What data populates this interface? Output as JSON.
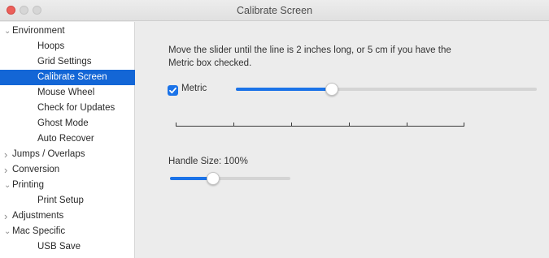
{
  "window": {
    "title": "Calibrate Screen"
  },
  "sidebar": {
    "items": [
      {
        "label": "Environment",
        "level": 0,
        "expander": "expanded",
        "selected": false
      },
      {
        "label": "Hoops",
        "level": 1,
        "selected": false
      },
      {
        "label": "Grid Settings",
        "level": 1,
        "selected": false
      },
      {
        "label": "Calibrate Screen",
        "level": 1,
        "selected": true
      },
      {
        "label": "Mouse Wheel",
        "level": 1,
        "selected": false
      },
      {
        "label": "Check for Updates",
        "level": 1,
        "selected": false
      },
      {
        "label": "Ghost Mode",
        "level": 1,
        "selected": false
      },
      {
        "label": "Auto Recover",
        "level": 1,
        "selected": false
      },
      {
        "label": "Jumps / Overlaps",
        "level": 0,
        "expander": "collapsed",
        "selected": false
      },
      {
        "label": "Conversion",
        "level": 0,
        "expander": "collapsed",
        "selected": false
      },
      {
        "label": "Printing",
        "level": 0,
        "expander": "expanded",
        "selected": false
      },
      {
        "label": "Print Setup",
        "level": 1,
        "selected": false
      },
      {
        "label": "Adjustments",
        "level": 0,
        "expander": "collapsed",
        "selected": false
      },
      {
        "label": "Mac Specific",
        "level": 0,
        "expander": "expanded",
        "selected": false
      },
      {
        "label": "USB Save",
        "level": 1,
        "selected": false
      }
    ]
  },
  "main": {
    "instructions": "Move the slider until the line is 2 inches long, or 5 cm if you have the Metric box checked.",
    "metric": {
      "label": "Metric",
      "checked": true,
      "slider_fraction": 0.32
    },
    "handle_size": {
      "label": "Handle Size: 100%",
      "slider_fraction": 0.36
    },
    "ruler_segments": 5
  },
  "colors": {
    "accent": "#1b73e8",
    "selection": "#1366d6",
    "close_button": "#ec5f5a"
  }
}
